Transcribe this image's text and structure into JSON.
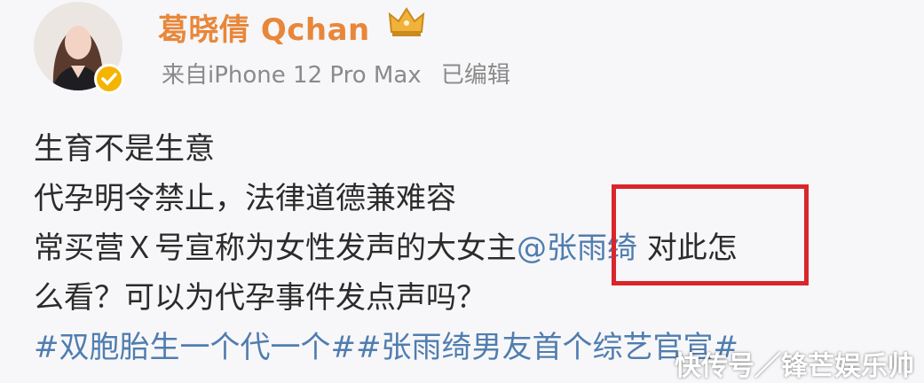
{
  "post": {
    "author": {
      "name": "葛晓倩 Qchan",
      "verified_icon": "verified-badge-icon",
      "crown_icon": "crown-icon",
      "accent_color": "#e8873a"
    },
    "meta": {
      "source": "来自iPhone 12 Pro Max",
      "edited": "已编辑"
    },
    "content": {
      "line1": "生育不是生意",
      "line2": "代孕明令禁止，法律道德兼难容",
      "line3_prefix": "常买营Ｘ号宣称为女性发声的大女主",
      "mention": "@张雨绮",
      "line3_suffix": " 对此怎",
      "line4": "么看？可以为代孕事件发点声吗？",
      "hashtags": "#双胞胎生一个代一个##张雨绮男友首个综艺官宣#"
    },
    "link_color": "#507daf",
    "highlight_color": "#d9262b"
  },
  "watermark": {
    "text": "快传号／锋芒娱乐帅"
  }
}
